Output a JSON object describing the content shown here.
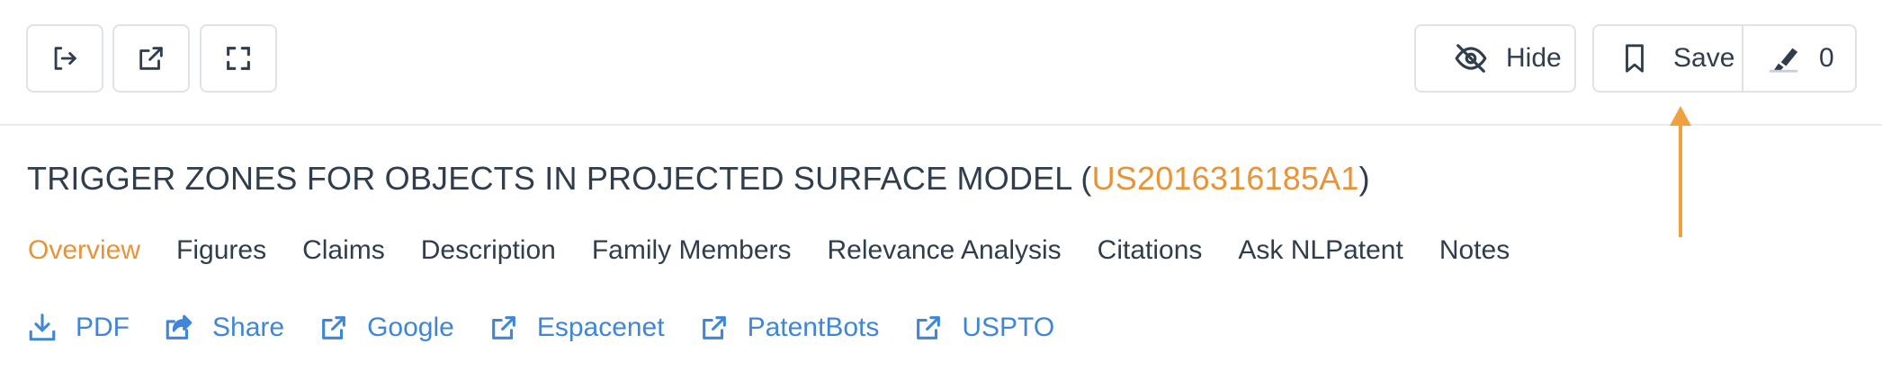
{
  "toolbar": {
    "exit_icon": "sign-out-icon",
    "open_icon": "external-link-icon",
    "fullscreen_icon": "expand-icon",
    "hide_label": "Hide",
    "save_label": "Save",
    "annotation_count": "0"
  },
  "patent": {
    "title_prefix": "TRIGGER ZONES FOR OBJECTS IN PROJECTED SURFACE MODEL (",
    "number": "US2016316185A1",
    "title_suffix": ")"
  },
  "tabs": [
    {
      "label": "Overview",
      "active": true
    },
    {
      "label": "Figures"
    },
    {
      "label": "Claims"
    },
    {
      "label": "Description"
    },
    {
      "label": "Family Members"
    },
    {
      "label": "Relevance Analysis"
    },
    {
      "label": "Citations"
    },
    {
      "label": "Ask NLPatent"
    },
    {
      "label": "Notes"
    }
  ],
  "links": [
    {
      "label": "PDF",
      "icon": "download-icon"
    },
    {
      "label": "Share",
      "icon": "share-icon"
    },
    {
      "label": "Google",
      "icon": "external-link-icon"
    },
    {
      "label": "Espacenet",
      "icon": "external-link-icon"
    },
    {
      "label": "PatentBots",
      "icon": "external-link-icon"
    },
    {
      "label": "USPTO",
      "icon": "external-link-icon"
    }
  ],
  "colors": {
    "accent_orange": "#e89436",
    "link_blue": "#3f86d6",
    "text": "#2f3d4c",
    "border": "#dfe3e8"
  }
}
